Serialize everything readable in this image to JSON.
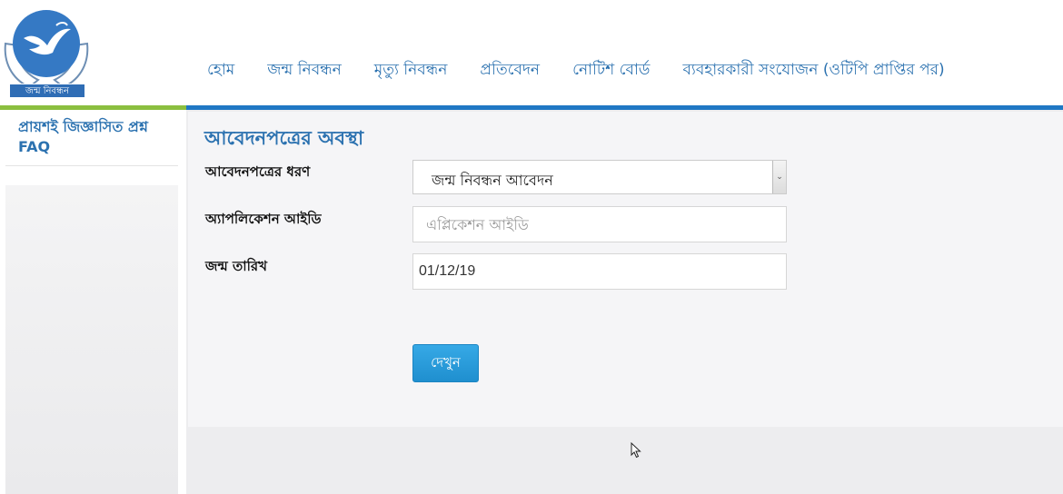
{
  "logo": {
    "label": "জন্ম নিবন্ধন",
    "globe_color": "#3579c4"
  },
  "nav": {
    "items": [
      {
        "label": "হোম"
      },
      {
        "label": "জন্ম নিবন্ধন"
      },
      {
        "label": "মৃত্যু নিবন্ধন"
      },
      {
        "label": "প্রতিবেদন"
      },
      {
        "label": "নোটিশ বোর্ড"
      },
      {
        "label": "ব্যবহারকারী সংযোজন (ওটিপি প্রাপ্তির পর)"
      }
    ]
  },
  "sidebar": {
    "faq_label": "প্রায়শই জিজ্ঞাসিত প্রশ্ন FAQ"
  },
  "form": {
    "title": "আবেদনপত্রের অবস্থা",
    "type_label": "আবেদনপত্রের ধরণ",
    "type_value": "জন্ম নিবন্ধন আবেদন",
    "app_id_label": "অ্যাপলিকেশন আইডি",
    "app_id_placeholder": "এপ্লিকেশন আইডি",
    "dob_label": "জন্ম তারিখ",
    "dob_value": "01/12/19",
    "submit_label": "দেখুন"
  },
  "colors": {
    "accent": "#2c72b0",
    "nav_bar": "#1f78c4",
    "nav_bar_left": "#8bbf3f",
    "button": "#2a9ddc"
  },
  "icons": {
    "logo": "dove-hands-globe-icon",
    "select_arrow": "chevron-down-icon",
    "cursor": "mouse-pointer-icon"
  }
}
